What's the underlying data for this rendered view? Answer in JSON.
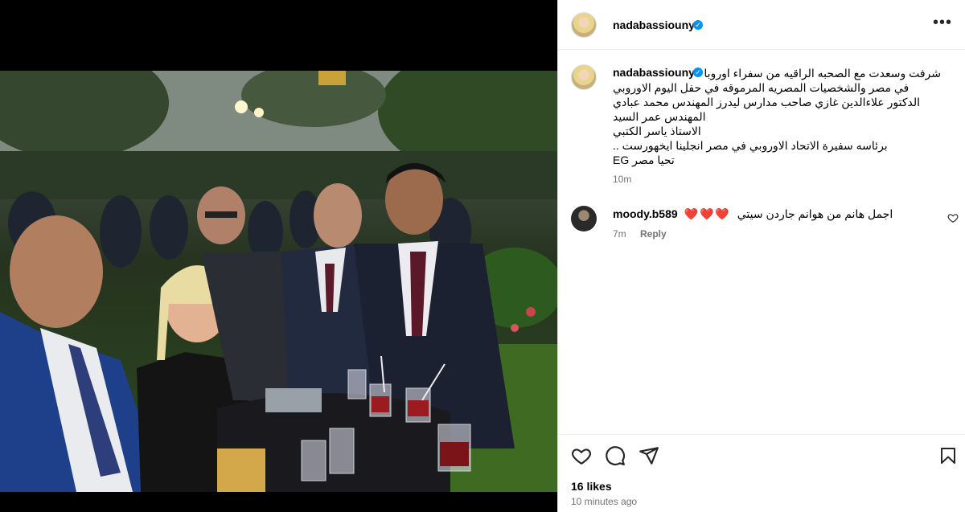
{
  "post": {
    "username": "nadabassiouny",
    "caption_lines": [
      "شرفت وسعدت مع الصحبه الراقيه من سفراء اوروبا",
      "في مصر والشخصيات المصريه المرموقه في حفل اليوم الاوروبي",
      "الدكتور علاءالدين غازي صاحب مدارس ليدرز المهندس محمد عبادي",
      "المهندس عمر السيد",
      "الاستاذ ياسر الكتبي",
      "برئاسه سفيرة الاتحاد الاوروبي في مصر انجلينا ايخهورست ..",
      "تحيا مصر EG"
    ],
    "caption_time": "10m"
  },
  "comment": {
    "username": "moody.b589",
    "text": "اجمل هانم من هوانم جاردن سيتي",
    "hearts": "❤️❤️❤️",
    "time": "7m",
    "reply_label": "Reply"
  },
  "stats": {
    "likes": "16 likes",
    "posted": "10 minutes ago"
  },
  "icons": {
    "more": "more-options-icon",
    "like": "heart-icon",
    "comment": "comment-icon",
    "share": "share-icon",
    "save": "bookmark-icon",
    "verified": "verified-badge-icon"
  },
  "colors": {
    "verified": "#0095f6",
    "muted": "#737373",
    "heart": "#e0245e"
  }
}
